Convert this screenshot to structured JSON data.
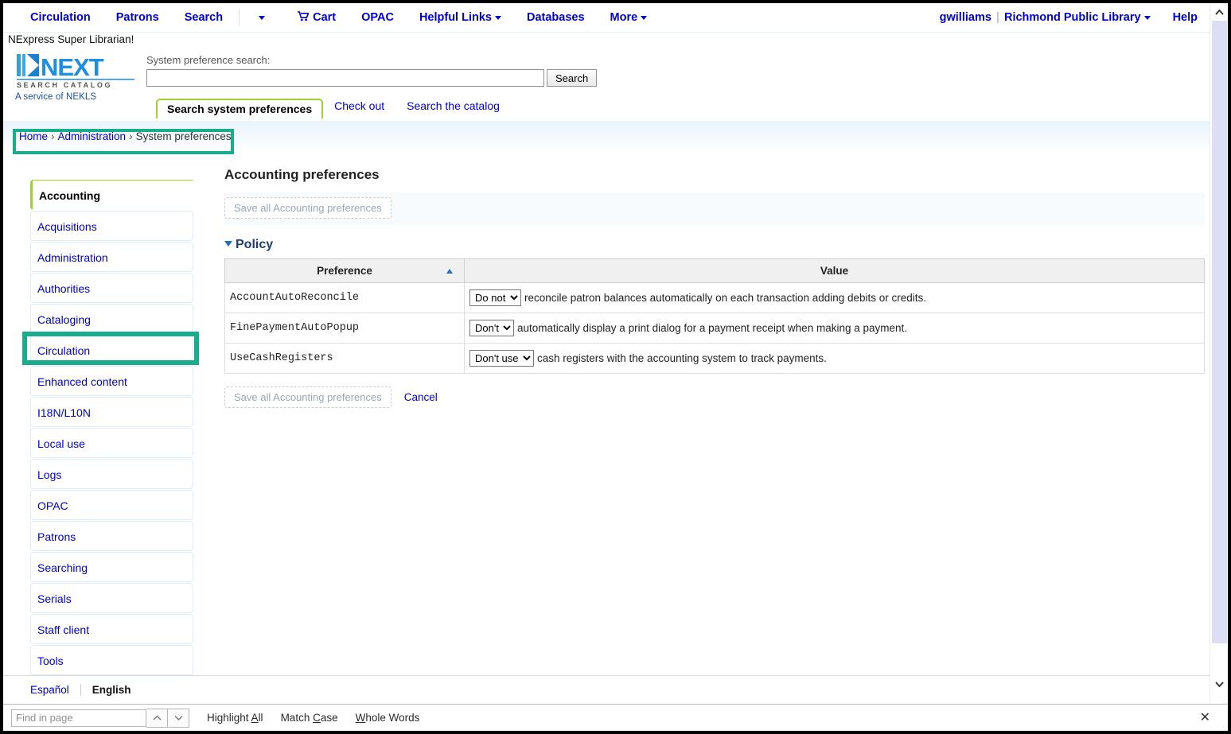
{
  "nav": {
    "left_items": [
      {
        "label": "Circulation",
        "icon": null,
        "caret": false
      },
      {
        "label": "Patrons",
        "icon": null,
        "caret": false
      },
      {
        "label": "Search",
        "icon": null,
        "caret": false
      }
    ],
    "dropdown_caret_label": "",
    "right_group": [
      {
        "label": "Cart",
        "icon": "cart-icon",
        "caret": false
      },
      {
        "label": "OPAC",
        "icon": null,
        "caret": false
      },
      {
        "label": "Helpful Links",
        "icon": null,
        "caret": true
      },
      {
        "label": "Databases",
        "icon": null,
        "caret": false
      },
      {
        "label": "More",
        "icon": null,
        "caret": true
      }
    ],
    "user": "gwilliams",
    "pipe": "|",
    "library": "Richmond Public Library",
    "help": "Help"
  },
  "subtitle": "NExpress Super Librarian!",
  "logo": {
    "wordmark": "NEXT",
    "subtext": "S E A R C H   C A T A L O G",
    "tagline": "A service of NEKLS"
  },
  "search": {
    "label": "System preference search:",
    "value": "",
    "placeholder": "",
    "button": "Search"
  },
  "tabs": [
    {
      "label": "Search system preferences",
      "active": true
    },
    {
      "label": "Check out",
      "active": false
    },
    {
      "label": "Search the catalog",
      "active": false
    }
  ],
  "breadcrumb": {
    "items": [
      "Home",
      "Administration",
      "System preferences"
    ],
    "separator": "›"
  },
  "sidebar": {
    "items": [
      {
        "label": "Accounting",
        "active": true
      },
      {
        "label": "Acquisitions",
        "active": false
      },
      {
        "label": "Administration",
        "active": false
      },
      {
        "label": "Authorities",
        "active": false
      },
      {
        "label": "Cataloging",
        "active": false
      },
      {
        "label": "Circulation",
        "active": false
      },
      {
        "label": "Enhanced content",
        "active": false
      },
      {
        "label": "I18N/L10N",
        "active": false
      },
      {
        "label": "Local use",
        "active": false
      },
      {
        "label": "Logs",
        "active": false
      },
      {
        "label": "OPAC",
        "active": false
      },
      {
        "label": "Patrons",
        "active": false
      },
      {
        "label": "Searching",
        "active": false
      },
      {
        "label": "Serials",
        "active": false
      },
      {
        "label": "Staff client",
        "active": false
      },
      {
        "label": "Tools",
        "active": false
      }
    ]
  },
  "content": {
    "title": "Accounting preferences",
    "save_top_label": "Save all Accounting preferences",
    "section_heading": "Policy",
    "columns": [
      "Preference",
      "Value"
    ],
    "sort_column": "Preference",
    "sort_direction": "asc",
    "rows": [
      {
        "preference": "AccountAutoReconcile",
        "select_value": "Do not",
        "text": "reconcile patron balances automatically on each transaction adding debits or credits."
      },
      {
        "preference": "FinePaymentAutoPopup",
        "select_value": "Don't",
        "text": "automatically display a print dialog for a payment receipt when making a payment."
      },
      {
        "preference": "UseCashRegisters",
        "select_value": "Don't use",
        "text": "cash registers with the accounting system to track payments."
      }
    ],
    "save_bottom_label": "Save all Accounting preferences",
    "cancel_label": "Cancel"
  },
  "language_bar": {
    "other": "Español",
    "current": "English"
  },
  "find_bar": {
    "placeholder": "Find in page",
    "value": "",
    "up_icon": "chevron-up-icon",
    "down_icon": "chevron-down-icon",
    "options": [
      {
        "pre": "Highlight ",
        "accel": "A",
        "post": "ll"
      },
      {
        "pre": "Match ",
        "accel": "C",
        "post": "ase"
      },
      {
        "pre": "",
        "accel": "W",
        "post": "hole Words"
      }
    ],
    "close_icon": "close-icon"
  },
  "colors": {
    "annotation_teal": "#17ad8d",
    "link_blue": "#0000cc",
    "tab_green": "#9fd130",
    "scrollbar_thumb": "#ddddf5"
  }
}
